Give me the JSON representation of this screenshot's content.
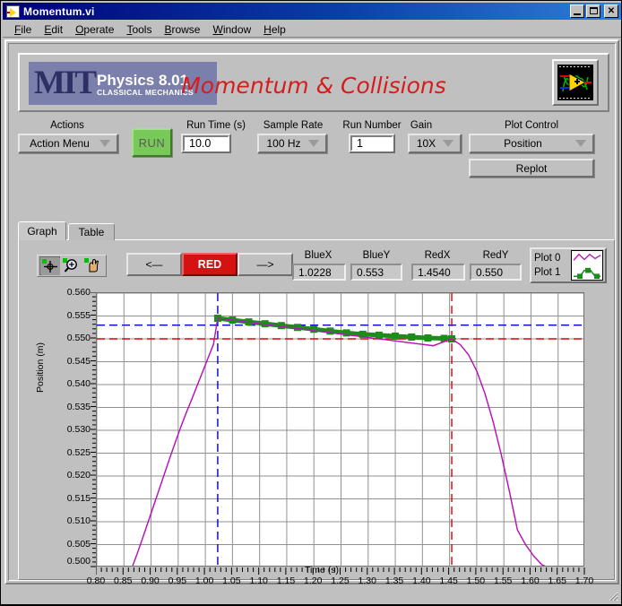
{
  "window": {
    "title": "Momentum.vi",
    "icon": "labview-vi-icon",
    "buttons": {
      "minimize": "_",
      "maximize": "□",
      "close": "×"
    }
  },
  "menu": {
    "items": [
      {
        "label": "File",
        "accel": "F"
      },
      {
        "label": "Edit",
        "accel": "E"
      },
      {
        "label": "Operate",
        "accel": "O"
      },
      {
        "label": "Tools",
        "accel": "T"
      },
      {
        "label": "Browse",
        "accel": "B"
      },
      {
        "label": "Window",
        "accel": "W"
      },
      {
        "label": "Help",
        "accel": "H"
      }
    ]
  },
  "header": {
    "logo_letters": "MIT",
    "logo_line1": "Physics 8.01",
    "logo_line2": "CLASSICAL MECHANICS",
    "title": "Momentum & Collisions",
    "title_color": "#d81c1c",
    "right_icon": "labview-logo-icon"
  },
  "controls": {
    "actions_label": "Actions",
    "actions_value": "Action Menu",
    "run_label": "RUN",
    "run_time_label": "Run Time (s)",
    "run_time_value": "10.0",
    "sample_rate_label": "Sample Rate",
    "sample_rate_value": "100 Hz",
    "run_number_label": "Run Number",
    "run_number_value": "1",
    "gain_label": "Gain",
    "gain_value": "10X",
    "plot_control_label": "Plot Control",
    "plot_control_value": "Position",
    "replot_label": "Replot"
  },
  "tabs": [
    {
      "label": "Graph",
      "active": true
    },
    {
      "label": "Table",
      "active": false
    }
  ],
  "graph_toolbar": {
    "palette": [
      {
        "name": "crosshair-cursor-tool",
        "selected": true
      },
      {
        "name": "zoom-tool",
        "selected": false
      },
      {
        "name": "pan-hand-tool",
        "selected": false
      }
    ],
    "prev_label": "<—",
    "cursor_label": "RED",
    "cursor_color": "#d41212",
    "next_label": "—>"
  },
  "readouts": [
    {
      "label": "BlueX",
      "value": "1.0228"
    },
    {
      "label": "BlueY",
      "value": "0.553"
    },
    {
      "label": "RedX",
      "value": "1.4540"
    },
    {
      "label": "RedY",
      "value": "0.550"
    }
  ],
  "legend": {
    "plots": [
      {
        "name": "Plot 0",
        "color": "#b814b8",
        "style": "line"
      },
      {
        "name": "Plot 1",
        "color": "#1d8c1d",
        "style": "line-markers"
      }
    ]
  },
  "chart_data": {
    "type": "line",
    "title": "",
    "xlabel": "Time (s)",
    "ylabel": "Position (m)",
    "xlim": [
      0.8,
      1.7
    ],
    "ylim": [
      0.5,
      0.56
    ],
    "xticks": [
      "0.80",
      "0.85",
      "0.90",
      "0.95",
      "1.00",
      "1.05",
      "1.10",
      "1.15",
      "1.20",
      "1.25",
      "1.30",
      "1.35",
      "1.40",
      "1.45",
      "1.50",
      "1.55",
      "1.60",
      "1.65",
      "1.70"
    ],
    "yticks": [
      "0.500",
      "0.505",
      "0.510",
      "0.515",
      "0.520",
      "0.525",
      "0.530",
      "0.535",
      "0.540",
      "0.545",
      "0.550",
      "0.555",
      "0.560"
    ],
    "grid": true,
    "legend_position": "top-right",
    "cursors": [
      {
        "name": "blue-cursor",
        "color": "#0000cc",
        "x": 1.0228,
        "y": 0.553
      },
      {
        "name": "red-cursor",
        "color": "#e00000",
        "x": 1.454,
        "y": 0.55
      }
    ],
    "series": [
      {
        "name": "Plot 0",
        "color": "#b814b8",
        "style": "line",
        "x": [
          0.865,
          0.875,
          0.885,
          0.895,
          0.905,
          0.915,
          0.925,
          0.935,
          0.945,
          0.955,
          0.965,
          0.975,
          0.985,
          0.995,
          1.005,
          1.015,
          1.0228,
          1.04,
          1.07,
          1.1,
          1.14,
          1.18,
          1.22,
          1.26,
          1.3,
          1.34,
          1.38,
          1.42,
          1.454,
          1.47,
          1.485,
          1.5,
          1.515,
          1.53,
          1.545,
          1.56,
          1.575,
          1.59,
          1.605,
          1.62,
          1.632
        ],
        "y": [
          0.5,
          0.5032,
          0.5066,
          0.5101,
          0.5136,
          0.5171,
          0.5206,
          0.5241,
          0.5275,
          0.5308,
          0.5339,
          0.5368,
          0.5398,
          0.5428,
          0.5458,
          0.5488,
          0.5545,
          0.5543,
          0.5538,
          0.5533,
          0.5527,
          0.5521,
          0.5515,
          0.5509,
          0.5503,
          0.5497,
          0.5491,
          0.5485,
          0.55,
          0.5487,
          0.5465,
          0.543,
          0.5381,
          0.532,
          0.5248,
          0.5168,
          0.5082,
          0.505,
          0.5025,
          0.5006,
          0.5
        ]
      },
      {
        "name": "Plot 1",
        "color": "#1d8c1d",
        "style": "line-markers",
        "x": [
          1.0228,
          1.05,
          1.08,
          1.11,
          1.14,
          1.17,
          1.2,
          1.23,
          1.26,
          1.29,
          1.32,
          1.35,
          1.38,
          1.41,
          1.44,
          1.454
        ],
        "y": [
          0.5545,
          0.5541,
          0.5537,
          0.5533,
          0.5529,
          0.5525,
          0.5521,
          0.5517,
          0.5513,
          0.551,
          0.5508,
          0.5506,
          0.5504,
          0.5502,
          0.5501,
          0.55
        ]
      }
    ]
  }
}
